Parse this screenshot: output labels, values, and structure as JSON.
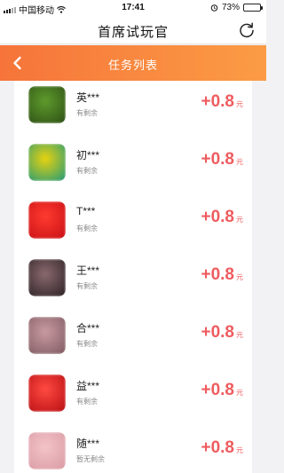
{
  "status_bar": {
    "carrier": "中国移动",
    "time": "17:41",
    "battery": "73%",
    "battery_level": 0.73
  },
  "header": {
    "title": "首席试玩官",
    "refresh_icon": "refresh-icon"
  },
  "nav": {
    "title": "任务列表",
    "back_icon": "chevron-left-icon"
  },
  "tasks": [
    {
      "name": "英***",
      "remaining": "有剩余",
      "reward": "+0.8",
      "unit": "元",
      "icon_colors": [
        "#5e9a2c",
        "#2d4f14"
      ]
    },
    {
      "name": "初***",
      "remaining": "有剩余",
      "reward": "+0.8",
      "unit": "元",
      "icon_colors": [
        "#e8d20e",
        "#1f9a7a"
      ]
    },
    {
      "name": "T***",
      "remaining": "有剩余",
      "reward": "+0.8",
      "unit": "元",
      "icon_colors": [
        "#ff3b30",
        "#c80f14"
      ]
    },
    {
      "name": "王***",
      "remaining": "有剩余",
      "reward": "+0.8",
      "unit": "元",
      "icon_colors": [
        "#8a6a6e",
        "#2b2024"
      ]
    },
    {
      "name": "合***",
      "remaining": "有剩余",
      "reward": "+0.8",
      "unit": "元",
      "icon_colors": [
        "#c99aa1",
        "#7e5a61"
      ]
    },
    {
      "name": "益***",
      "remaining": "有剩余",
      "reward": "+0.8",
      "unit": "元",
      "icon_colors": [
        "#ff4a42",
        "#b80e12"
      ]
    },
    {
      "name": "随***",
      "remaining": "暂无剩余",
      "reward": "+0.8",
      "unit": "元",
      "icon_colors": [
        "#f3c4c9",
        "#d99aa2"
      ]
    }
  ]
}
